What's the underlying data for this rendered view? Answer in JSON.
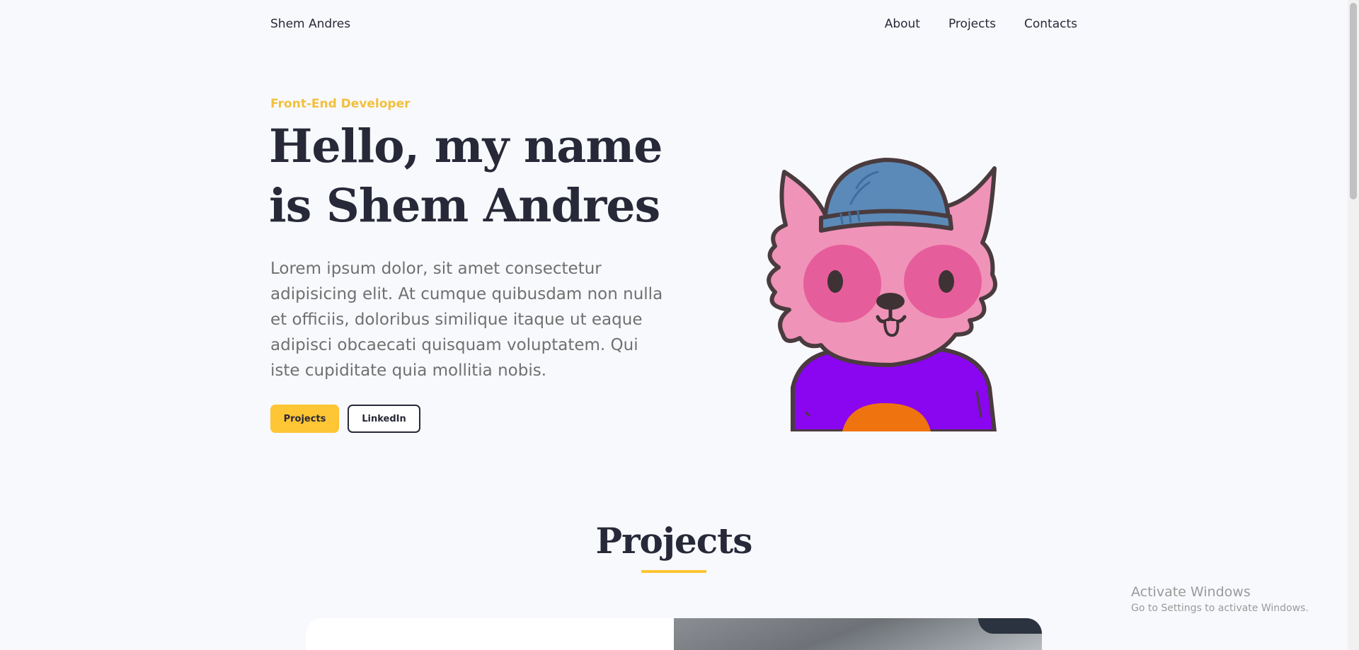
{
  "header": {
    "logo": "Shem Andres",
    "nav": [
      "About",
      "Projects",
      "Contacts"
    ]
  },
  "hero": {
    "eyebrow": "Front-End Developer",
    "title_line1": "Hello, my name",
    "title_line2": "is Shem Andres",
    "description": "Lorem ipsum dolor, sit amet consectetur adipisicing elit. At cumque quibusdam non nulla et officiis, doloribus similique itaque ut eaque adipisci obcaecati quisquam voluptatem. Qui iste cupiditate quia mollitia nobis.",
    "primary_button": "Projects",
    "secondary_button": "LinkedIn"
  },
  "projects": {
    "title": "Projects"
  },
  "watermark": {
    "title": "Activate Windows",
    "subtitle": "Go to Settings to activate Windows."
  },
  "colors": {
    "accent": "#fec534",
    "text": "#282938",
    "background": "#f8f9fc"
  }
}
